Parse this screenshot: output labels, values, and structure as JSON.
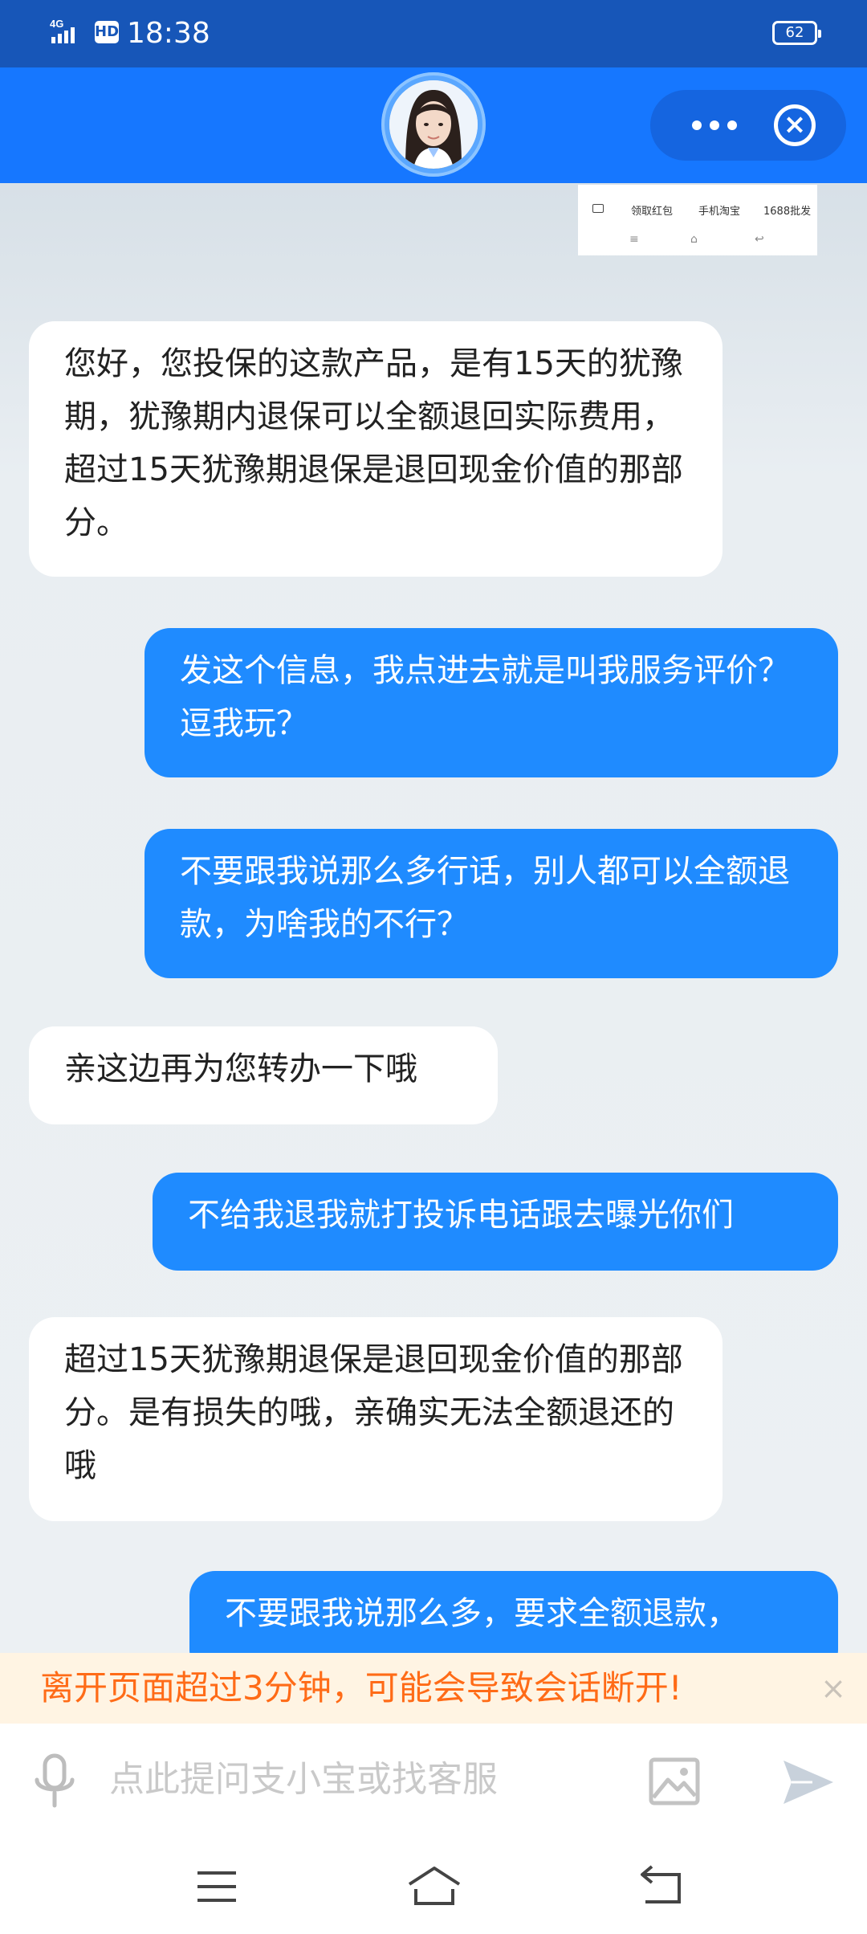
{
  "status_bar": {
    "network": "4G",
    "hd": "HD",
    "time": "18:38",
    "battery": "62"
  },
  "header": {
    "avatar_alt": "customer service avatar",
    "more_icon": "more-dots-icon",
    "close_icon": "close-circle-icon"
  },
  "mini_strip": {
    "items": [
      "领取红包",
      "手机淘宝",
      "1688批发"
    ]
  },
  "messages": [
    {
      "side": "left",
      "text": "您好，您投保的这款产品，是有15天的犹豫期，犹豫期内退保可以全额退回实际费用，超过15天犹豫期退保是退回现金价值的那部分。"
    },
    {
      "side": "right",
      "text": "发这个信息，我点进去就是叫我服务评价？逗我玩？"
    },
    {
      "side": "right",
      "text": "不要跟我说那么多行话，别人都可以全额退款，为啥我的不行？"
    },
    {
      "side": "left",
      "text": "亲这边再为您转办一下哦"
    },
    {
      "side": "right",
      "text": "不给我退我就打投诉电话跟去曝光你们"
    },
    {
      "side": "left",
      "text": "超过15天犹豫期退保是退回现金价值的那部分。是有损失的哦，亲确实无法全额退还的哦"
    },
    {
      "side": "right",
      "text": "不要跟我说那么多，要求全额退款，"
    }
  ],
  "notice": {
    "text": "离开页面超过3分钟，可能会导致会话断开!",
    "close": "×"
  },
  "input": {
    "placeholder": "点此提问支小宝或找客服"
  },
  "colors": {
    "status_bar": "#1756b8",
    "header": "#1677ff",
    "bubble_right": "#1f8bff",
    "bubble_left": "#ffffff",
    "notice_text": "#ff6b17",
    "notice_bg": "#fff4e3"
  }
}
